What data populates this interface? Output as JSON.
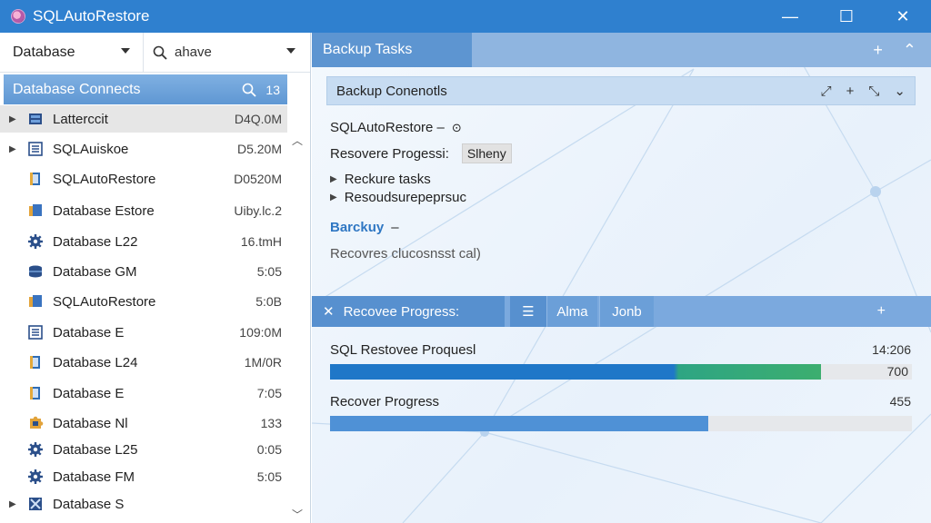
{
  "window": {
    "title": "SQLAutoRestore",
    "minimize": "—",
    "maximize": "☐",
    "close": "✕"
  },
  "left": {
    "select_label": "Database",
    "search_value": "ahave",
    "panel_title": "Database Connects",
    "panel_count": "13",
    "items": [
      {
        "name": "Latterccit",
        "value": "D4Q.0M",
        "icon": "server-icon",
        "arrow": true,
        "selected": true
      },
      {
        "name": "SQLAuiskoe",
        "value": "D5.20M",
        "icon": "list-icon",
        "arrow": true
      },
      {
        "name": "SQLAutoRestore",
        "value": "D0520M",
        "icon": "file-icon"
      },
      {
        "name": "Database Estore",
        "value": "Uiby.lc.2",
        "icon": "folder-icon"
      },
      {
        "name": "Database L22",
        "value": "16.tmH",
        "icon": "gear-icon"
      },
      {
        "name": "Database GM",
        "value": "5:05",
        "icon": "database-icon"
      },
      {
        "name": "SQLAutoRestore",
        "value": "5:0B",
        "icon": "folder-icon"
      },
      {
        "name": "Database E",
        "value": "109:0M",
        "icon": "list-icon"
      },
      {
        "name": "Database L24",
        "value": "1M/0R",
        "icon": "file-icon"
      },
      {
        "name": "Database E",
        "value": "7:05",
        "icon": "file-icon"
      },
      {
        "name": "Database Nl",
        "value": "133",
        "icon": "puzzle-icon"
      },
      {
        "name": "Database L25",
        "value": "0:05",
        "icon": "gear-icon"
      },
      {
        "name": "Database FM",
        "value": "5:05",
        "icon": "gear-icon"
      },
      {
        "name": "Database S",
        "value": "",
        "icon": "tools-icon",
        "arrow": true
      }
    ]
  },
  "right": {
    "tab_title": "Backup Tasks",
    "conn_title": "Backup Conenotls",
    "line1": "SQLAutoRestore –",
    "progress_label": "Resovere Progessi:",
    "status": "Slheny",
    "task1": "Reckure tasks",
    "task2": "Resoudsurepeprsuc",
    "backup_link": "Barckuy",
    "backup_dash": "–",
    "recover_text": "Recovres clucosnsst cal)",
    "progress_tab": "Recovee Progress:",
    "tab_alma": "Alma",
    "tab_jonb": "Jonb",
    "prog1": {
      "label": "SQL Restovee Proquesl",
      "num1": "14:206",
      "num2": "700",
      "fraction": 0.843
    },
    "prog2": {
      "label": "Recover Progress",
      "num1": "455",
      "fraction": 0.65
    },
    "accent": "#1f77c8",
    "accent2": "#2ea583"
  }
}
